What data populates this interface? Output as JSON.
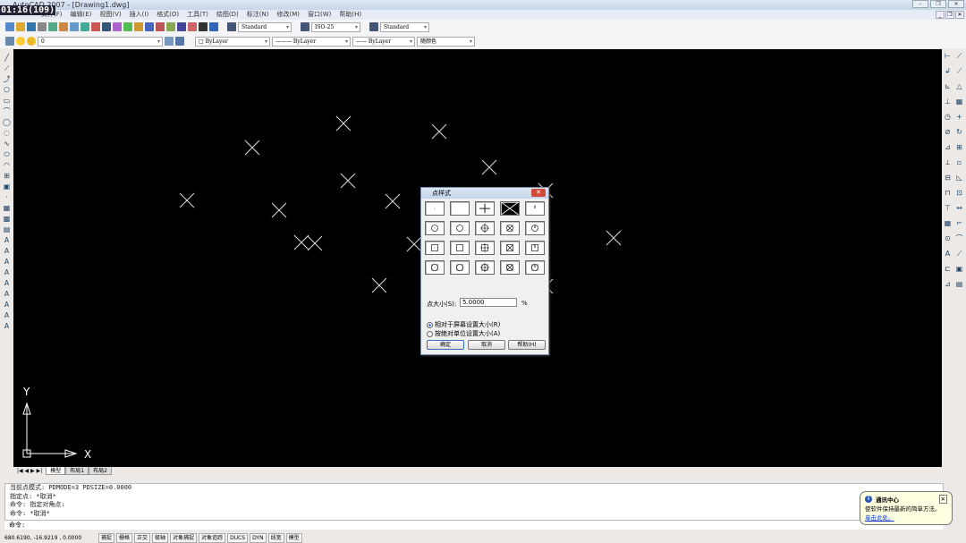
{
  "title": "AutoCAD 2007 - [Drawing1.dwg]",
  "timestamp": "01:16(109)",
  "menu": [
    "文件(F)",
    "编辑(E)",
    "视图(V)",
    "插入(I)",
    "格式(O)",
    "工具(T)",
    "绘图(D)",
    "标注(N)",
    "修改(M)",
    "窗口(W)",
    "帮助(H)"
  ],
  "styles": {
    "text_style": "Standard",
    "dim_style": "ISO-25",
    "table_style": "Standard"
  },
  "layers": {
    "layer": "0",
    "color": "ByLayer",
    "linetype": "ByLayer",
    "lineweight": "ByLayer",
    "plotstyle": "随颜色"
  },
  "axes": {
    "y": "Y",
    "x": "X"
  },
  "tabs": [
    "模型",
    "布局1",
    "布局2"
  ],
  "dialog": {
    "title": "点样式",
    "size_label": "点大小(S):",
    "size_value": "5.0000",
    "percent": "%",
    "radio_relative": "相对于屏幕设置大小(R)",
    "radio_absolute": "按绝对单位设置大小(A)",
    "selected_radio": "relative",
    "ok": "确定",
    "cancel": "取消",
    "help": "帮助(H)",
    "selected_style_index": 3
  },
  "command_history": [
    "当前点模式:  PDMODE=3  PDSIZE=0.0000",
    "指定点: *取消*",
    "命令: 指定对角点:",
    "命令: *取消*"
  ],
  "command_prompt": "命令:",
  "status": {
    "coords": "680.6190,  -16.9219 , 0.0000",
    "toggles": [
      "捕捉",
      "栅格",
      "正交",
      "极轴",
      "对象捕捉",
      "对象追踪",
      "DUCS",
      "DYN",
      "线宽",
      "模型"
    ]
  },
  "balloon": {
    "title": "通讯中心",
    "text": "使软件保持最新的简单方法。",
    "link": "单击此处。"
  }
}
